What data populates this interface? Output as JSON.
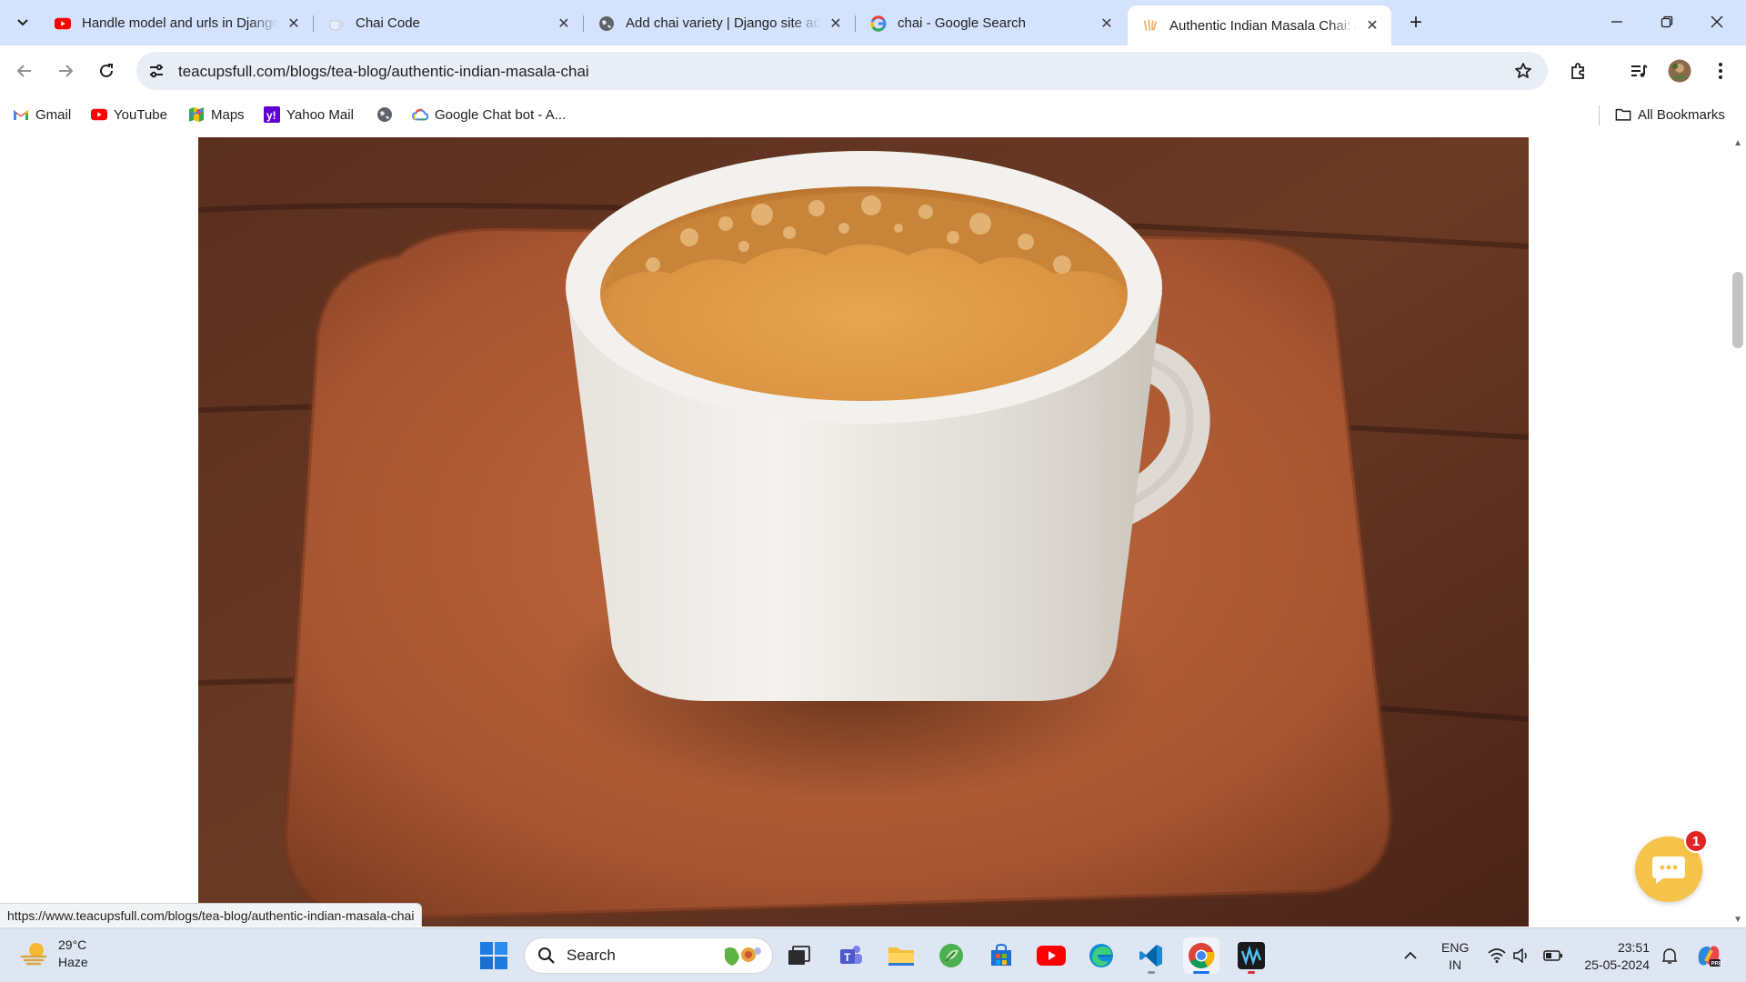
{
  "browser": {
    "tabs": [
      {
        "title": "Handle model and urls in Django",
        "favicon": "youtube-icon"
      },
      {
        "title": "Chai Code",
        "favicon": "chai-code-icon"
      },
      {
        "title": "Add chai variety | Django site admin",
        "favicon": "globe-icon"
      },
      {
        "title": "chai - Google Search",
        "favicon": "google-icon"
      },
      {
        "title": "Authentic Indian Masala Chai: A",
        "favicon": "teacupsfull-icon",
        "active": true
      }
    ],
    "address_bar": {
      "url": "teacupsfull.com/blogs/tea-blog/authentic-indian-masala-chai"
    },
    "bookmarks": [
      {
        "label": "Gmail",
        "icon": "gmail-icon"
      },
      {
        "label": "YouTube",
        "icon": "youtube-icon"
      },
      {
        "label": "Maps",
        "icon": "maps-icon"
      },
      {
        "label": "Yahoo Mail",
        "icon": "yahoo-icon"
      },
      {
        "label": "",
        "icon": "globe-icon"
      },
      {
        "label": "Google Chat bot - A...",
        "icon": "google-cloud-icon"
      }
    ],
    "all_bookmarks_label": "All Bookmarks",
    "status_url": "https://www.teacupsfull.com/blogs/tea-blog/authentic-indian-masala-chai"
  },
  "page": {
    "chat_badge_count": "1",
    "hero_image": "cup-of-masala-chai-on-wooden-tray"
  },
  "taskbar": {
    "weather": {
      "temp": "29°C",
      "condition": "Haze"
    },
    "search_placeholder": "Search",
    "apps": [
      "file-explorer-window",
      "teams",
      "file-explorer",
      "unknown-green-app",
      "microsoft-store",
      "youtube",
      "edge",
      "vscode",
      "chrome",
      "waves-app"
    ],
    "language": {
      "line1": "ENG",
      "line2": "IN"
    },
    "clock": {
      "time": "23:51",
      "date": "25-05-2024"
    }
  },
  "colors": {
    "tabstrip": "#d3e3fd",
    "omnibox": "#e9eef6",
    "chat_bubble": "#f5c24a",
    "badge": "#e02424",
    "taskbar": "#dfe6f3"
  }
}
